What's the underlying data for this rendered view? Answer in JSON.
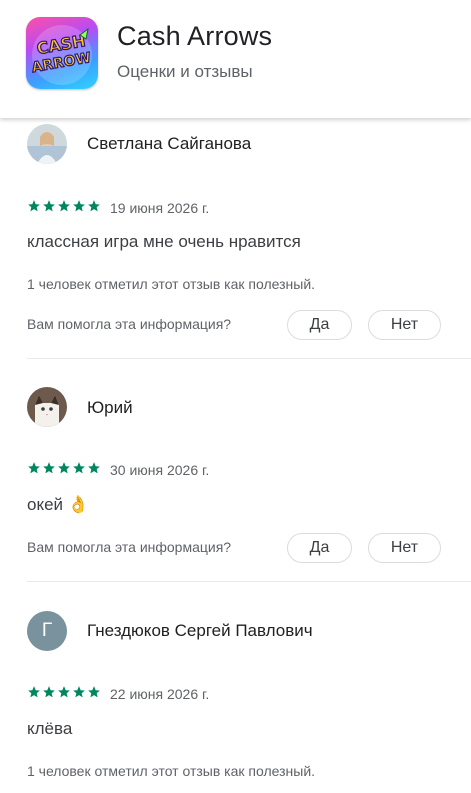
{
  "app": {
    "title": "Cash Arrows",
    "subtitle": "Оценки и отзывы",
    "icon_text_line1": "CASH",
    "icon_text_line2": "ARROW"
  },
  "colors": {
    "star": "#01875f",
    "avatar_letter_bg": "#7a929d"
  },
  "reviews": [
    {
      "author": "Светлана Сайганова",
      "rating": 5,
      "date": "19 июня 2026 г.",
      "text": "классная игра мне очень нравится",
      "helpful_count": "1 человек отметил этот отзыв как полезный.",
      "question": "Вам помогла эта информация?",
      "yes_label": "Да",
      "no_label": "Нет",
      "avatar_icon": "photo-avatar-icon"
    },
    {
      "author": "Юрий",
      "rating": 5,
      "date": "30 июня 2026 г.",
      "text": "окей 👌",
      "question": "Вам помогла эта информация?",
      "yes_label": "Да",
      "no_label": "Нет",
      "avatar_icon": "cat-avatar-icon"
    },
    {
      "author": "Гнездюков Сергей Павлович",
      "avatar_letter": "Г",
      "rating": 5,
      "date": "22 июня 2026 г.",
      "text": "клёва",
      "helpful_count": "1 человек отметил этот отзыв как полезный."
    }
  ]
}
